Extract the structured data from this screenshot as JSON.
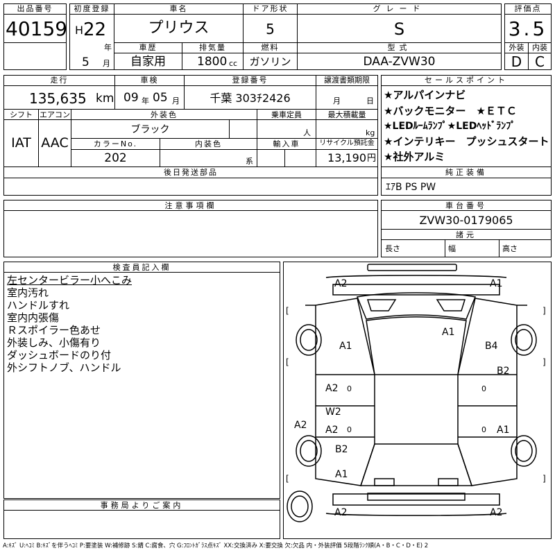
{
  "header": {
    "lot_no_label": "出品番号",
    "lot_no": "40159",
    "first_reg_label": "初度登録",
    "era": "H",
    "year": "22",
    "year_unit": "年",
    "month": "5",
    "month_unit": "月",
    "car_name_label": "車名",
    "car_name": "プリウス",
    "history_label": "車歴",
    "history": "自家用",
    "displacement_label": "排気量",
    "displacement": "1800",
    "displacement_unit": "cc",
    "door_label": "ドア形状",
    "doors": "5",
    "fuel_label": "燃料",
    "fuel": "ガソリン",
    "grade_label": "グレード",
    "grade": "S",
    "model_label": "型式",
    "model": "DAA-ZVW30",
    "score_label": "評価点",
    "score": "3.5",
    "exterior_label": "外装",
    "exterior": "D",
    "interior_label": "内装",
    "interior": "C"
  },
  "row2": {
    "mileage_label": "走行",
    "mileage": "135,635",
    "mileage_unit": "km",
    "inspection_label": "車検",
    "insp_year": "09",
    "insp_year_unit": "年",
    "insp_month": "05",
    "insp_month_unit": "月",
    "reg_no_label": "登録番号",
    "reg_no": "千葉 303ﾁ2426",
    "transfer_label": "譲渡書類期限",
    "transfer_month_unit": "月",
    "transfer_day_unit": "日",
    "shift_label": "シフト",
    "shift": "IAT",
    "ac_label": "エアコン",
    "ac": "AAC",
    "ext_color_label": "外装色",
    "ext_color": "ブラック",
    "capacity_label": "乗車定員",
    "capacity_unit": "人",
    "load_label": "最大積載量",
    "load_unit": "kg",
    "color_no_label": "カラーNo.",
    "color_no": "202",
    "int_color_label": "内装色",
    "int_color_unit": "系",
    "import_label": "輸入車",
    "recycle_label": "リサイクル預託金",
    "recycle": "13,190",
    "recycle_unit": "円",
    "later_parts_label": "後日発送部品"
  },
  "sales": {
    "label": "セールスポイント",
    "items": [
      "★アルパインナビ",
      "★バックモニター　★ＥＴＣ",
      "★LEDﾙｰﾑﾗﾝﾌﾟ★LEDﾍｯﾄﾞﾗﾝﾌﾟ",
      "★インテリキー　プッシュスタート",
      "★社外アルミ"
    ]
  },
  "equipment": {
    "label": "純正装備",
    "value": "ｴｱB PS PW"
  },
  "notes_label": "注意事項欄",
  "chassis": {
    "label": "車台番号",
    "value": "ZVW30-0179065",
    "dims_label": "諸元",
    "length": "長さ",
    "width": "幅",
    "height": "高さ"
  },
  "inspector": {
    "label": "検査員記入欄",
    "lines": [
      "左センタービラー小へこみ",
      "室内汚れ",
      "ハンドルすれ",
      "室内内張傷",
      "Ｒスポイラー色あせ",
      "外装しみ、小傷有り",
      "ダッシュボードのり付",
      "外シフトノブ、ハンドル"
    ]
  },
  "office_label": "事務局よりご案内",
  "legend": "A:ｷｽﾞ U:ﾍｺﾐ B:ｷｽﾞを伴うﾍｺﾐ P:要塗装 W:補修跡 S:錆 C:腐食、穴 G:ﾌﾛﾝﾄｶﾞﾗｽ点ｷｽﾞ XX:交換済み X:要交換 欠:欠品 内・外装評価 5段階ﾗﾝｸ順(A・B・C・D・E) 2",
  "damage": {
    "front_left": "A2",
    "front_right": "A1",
    "hood": "A1",
    "left_front_fender": "A1",
    "right_front_fender": "B4",
    "left_front_door": "A2",
    "right_front_door": "B2",
    "left_pillar": "W2",
    "left_rear_door": "A2",
    "left_side": "A2",
    "right_rear_door": "A1",
    "left_rear_fender": "B2",
    "left_rear": "A1",
    "rear_left": "A2",
    "rear_right": "A2",
    "bracket_left": "[",
    "bracket_right": "]",
    "zero": "0"
  }
}
